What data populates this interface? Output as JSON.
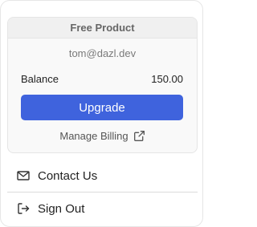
{
  "card": {
    "plan_label": "Free Product",
    "email": "tom@dazl.dev",
    "balance_label": "Balance",
    "balance_value": "150.00",
    "upgrade_label": "Upgrade",
    "manage_billing_label": "Manage Billing",
    "manage_billing_icon": "external-link-icon"
  },
  "menu": {
    "contact_label": "Contact Us",
    "contact_icon": "mail-icon",
    "signout_label": "Sign Out",
    "signout_icon": "sign-out-icon"
  },
  "colors": {
    "accent": "#3f63dd",
    "card_background": "#f9f9f9",
    "header_background": "#f0f0f0"
  }
}
